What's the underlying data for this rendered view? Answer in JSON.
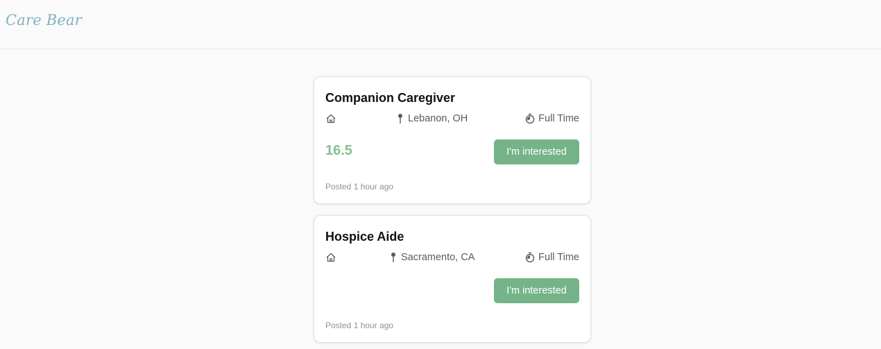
{
  "app": {
    "brand": "Care Bear"
  },
  "jobs": [
    {
      "title": "Companion Caregiver",
      "location": "Lebanon, OH",
      "job_type": "Full Time",
      "pay": "16.5",
      "button_label": "I'm interested",
      "posted": "Posted 1 hour ago"
    },
    {
      "title": "Hospice Aide",
      "location": "Sacramento, CA",
      "job_type": "Full Time",
      "pay": "",
      "button_label": "I'm interested",
      "posted": "Posted 1 hour ago"
    }
  ],
  "icons": {
    "home": "home-icon",
    "location": "map-pin-icon",
    "time": "stopwatch-icon"
  },
  "colors": {
    "brand": "#7fb0c4",
    "pay": "#84bf94",
    "button": "#75b388"
  }
}
